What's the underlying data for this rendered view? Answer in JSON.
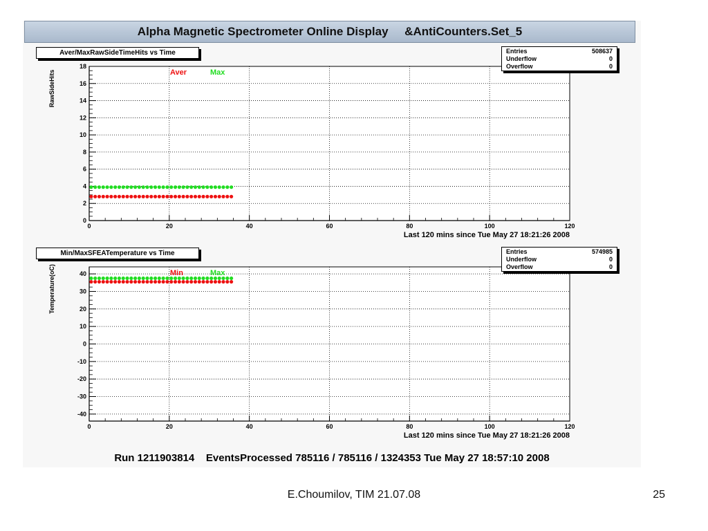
{
  "header": {
    "title": "Alpha Magnetic Spectrometer Online Display     &AntiCounters.Set_5"
  },
  "chart_data": [
    {
      "type": "scatter",
      "title": "Aver/MaxRawSideTimeHits vs Time",
      "ylabel": "RawSideHits",
      "xlabel": "Last 120 mins since Tue May 27 18:21:26 2008",
      "xlim": [
        0,
        120
      ],
      "ylim": [
        0,
        18
      ],
      "xticks": [
        0,
        20,
        40,
        60,
        80,
        100,
        120
      ],
      "yticks": [
        0,
        2,
        4,
        6,
        8,
        10,
        12,
        14,
        16,
        18
      ],
      "grid": true,
      "stats": {
        "entries_label": "Entries",
        "entries": "508637",
        "underflow_label": "Underflow",
        "underflow": "0",
        "overflow_label": "Overflow",
        "overflow": "0"
      },
      "series": [
        {
          "name": "Aver",
          "color": "#ee1111",
          "x_start": 0.5,
          "x_end": 36,
          "x_step": 1,
          "y": 2.8
        },
        {
          "name": "Max",
          "color": "#22dd22",
          "x_start": 0.5,
          "x_end": 36,
          "x_step": 1,
          "y": 3.9
        }
      ]
    },
    {
      "type": "scatter",
      "title": "Min/MaxSFEATemperature vs Time",
      "ylabel": "Temperature(oC)",
      "xlabel": "Last 120 mins since Tue May 27 18:21:26 2008",
      "xlim": [
        0,
        120
      ],
      "ylim": [
        -44,
        44
      ],
      "xticks": [
        0,
        20,
        40,
        60,
        80,
        100,
        120
      ],
      "yticks": [
        -40,
        -30,
        -20,
        -10,
        0,
        10,
        20,
        30,
        40
      ],
      "grid": true,
      "stats": {
        "entries_label": "Entries",
        "entries": "574985",
        "underflow_label": "Underflow",
        "underflow": "0",
        "overflow_label": "Overflow",
        "overflow": "0"
      },
      "series": [
        {
          "name": "Min",
          "color": "#ee1111",
          "x_start": 0.5,
          "x_end": 36,
          "x_step": 1,
          "y": 35.5
        },
        {
          "name": "Max",
          "color": "#22dd22",
          "x_start": 0.5,
          "x_end": 36,
          "x_step": 1,
          "y": 37.5
        }
      ]
    }
  ],
  "run_info": "Run 1211903814    EventsProcessed 785116 / 785116 / 1324353 Tue May 27 18:57:10 2008",
  "footer": {
    "author": "E.Choumilov, TIM 21.07.08",
    "page": "25"
  }
}
